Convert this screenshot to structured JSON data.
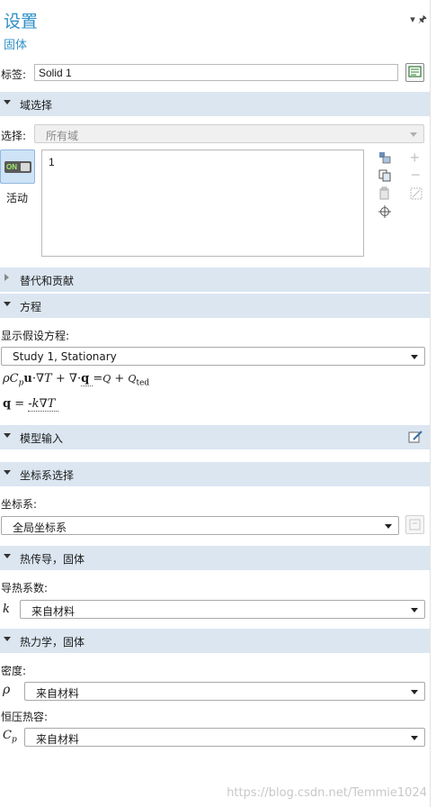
{
  "header": {
    "title": "设置",
    "subtitle": "固体"
  },
  "label_field": {
    "label": "标签:",
    "value": "Solid 1"
  },
  "domain_selection": {
    "section_title": "域选择",
    "selection_label": "选择:",
    "selection_value": "所有域",
    "active_label": "活动",
    "toggle_text": "ON",
    "list_items": [
      "1"
    ]
  },
  "sections": {
    "override": "替代和贡献",
    "equation": "方程",
    "model_input": "模型输入",
    "coord_sel": "坐标系选择",
    "heat_conduction": "热传导，固体",
    "thermodynamics": "热力学，固体"
  },
  "equation": {
    "show_label": "显示假设方程:",
    "study_value": "Study 1, Stationary"
  },
  "coord": {
    "label": "坐标系:",
    "value": "全局坐标系"
  },
  "conduction": {
    "label": "导热系数:",
    "symbol": "k",
    "value": "来自材料"
  },
  "thermo": {
    "density_label": "密度:",
    "density_symbol": "ρ",
    "density_value": "来自材料",
    "cp_label": "恒压热容:",
    "cp_value": "来自材料"
  },
  "watermark": "https://blog.csdn.net/Temmie1024"
}
